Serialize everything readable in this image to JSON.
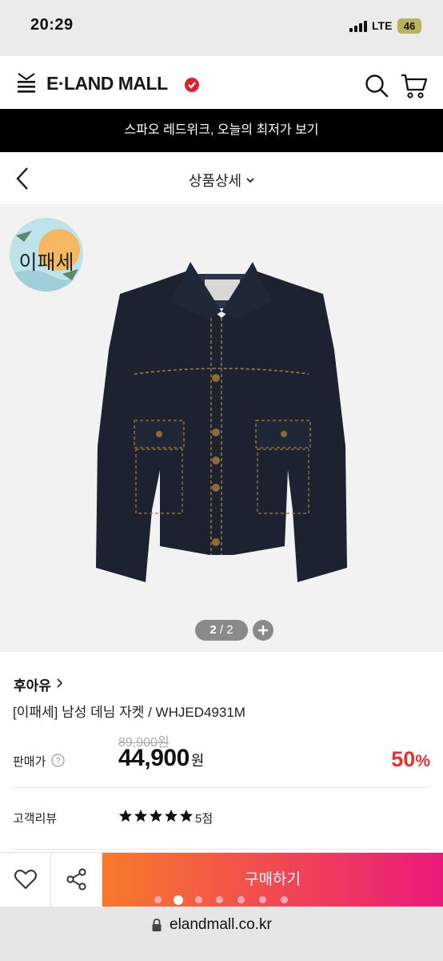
{
  "status_bar": {
    "time": "20:29",
    "network": "LTE",
    "battery": "46"
  },
  "header": {
    "logo_text": "E·LAND MALL",
    "icons": [
      "menu-icon",
      "search-icon",
      "cart-icon"
    ]
  },
  "promo_banner": {
    "text": "스파오 레드위크, 오늘의 최저가 보기"
  },
  "page_nav": {
    "title": "상품상세"
  },
  "product_image": {
    "sticker_text": "이패세",
    "counter_current": "2",
    "counter_total": "2",
    "jacket_color": "#1c2230"
  },
  "product": {
    "brand": "후아유",
    "name": "[이패세] 남성 데님 자켓 / WHJED4931M",
    "original_price": "89,900원",
    "price_label": "판매가",
    "sale_price": "44,900",
    "sale_price_unit": "원",
    "discount_value": "50",
    "discount_unit": "%"
  },
  "review": {
    "label": "고객리뷰",
    "rating": 5,
    "rating_text": "5점"
  },
  "action_bar": {
    "buy_label": "구매하기"
  },
  "colors": {
    "accent_red": "#e8302c",
    "buy_gradient_start": "#f77a2a",
    "buy_gradient_end": "#ea1a7a"
  },
  "browser": {
    "url": "elandmall.co.kr"
  }
}
